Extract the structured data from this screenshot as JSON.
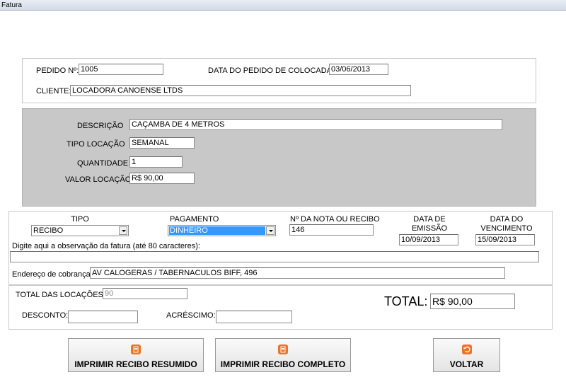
{
  "window": {
    "title": "Fatura"
  },
  "header": {
    "pedido_label": "PEDIDO Nº:",
    "pedido_value": "1005",
    "data_pedido_label": "DATA DO PEDIDO DE COLOCADA:",
    "data_pedido_value": "03/06/2013",
    "cliente_label": "CLIENTE:",
    "cliente_value": "LOCADORA CANOENSE LTDS"
  },
  "item": {
    "descricao_label": "DESCRIÇÃO",
    "descricao_value": "CAÇAMBA DE 4 METROS",
    "tipo_locacao_label": "TIPO LOCAÇÃO",
    "tipo_locacao_value": "SEMANAL",
    "quantidade_label": "QUANTIDADE",
    "quantidade_value": "1",
    "valor_locacao_label": "VALOR LOCAÇÃO",
    "valor_locacao_value": "R$ 90,00"
  },
  "billing": {
    "tipo_label": "TIPO",
    "tipo_value": "RECIBO",
    "pagamento_label": "PAGAMENTO",
    "pagamento_value": "DINHEIRO",
    "nota_label": "Nº DA NOTA OU RECIBO",
    "nota_value": "146",
    "emissao_label_1": "DATA DE",
    "emissao_label_2": "EMISSÃO",
    "emissao_value": "10/09/2013",
    "vencimento_label_1": "DATA DO",
    "vencimento_label_2": "VENCIMENTO",
    "vencimento_value": "15/09/2013",
    "observacao_label": "Digite aqui a observação da fatura (até 80 caracteres):",
    "observacao_value": "",
    "endereco_label": "Endereço de cobrança",
    "endereco_value": "AV CALOGERAS / TABERNACULOS BIFF, 496"
  },
  "totals": {
    "total_locacoes_label": "TOTAL DAS LOCAÇÕES:",
    "total_locacoes_value": "90",
    "desconto_label": "DESCONTO:",
    "desconto_value": "",
    "acrescimo_label": "ACRÉSCIMO:",
    "acrescimo_value": "",
    "total_label": "TOTAL:",
    "total_value": "R$ 90,00"
  },
  "buttons": {
    "resumido": "IMPRIMIR RECIBO RESUMIDO",
    "completo": "IMPRIMIR RECIBO COMPLETO",
    "voltar": "VOLTAR"
  },
  "icons": {
    "print": "document-icon",
    "back": "back-arrow-icon"
  },
  "colors": {
    "accent": "#f07222",
    "selection": "#3399ff",
    "panel_grey": "#c8c8c8"
  }
}
